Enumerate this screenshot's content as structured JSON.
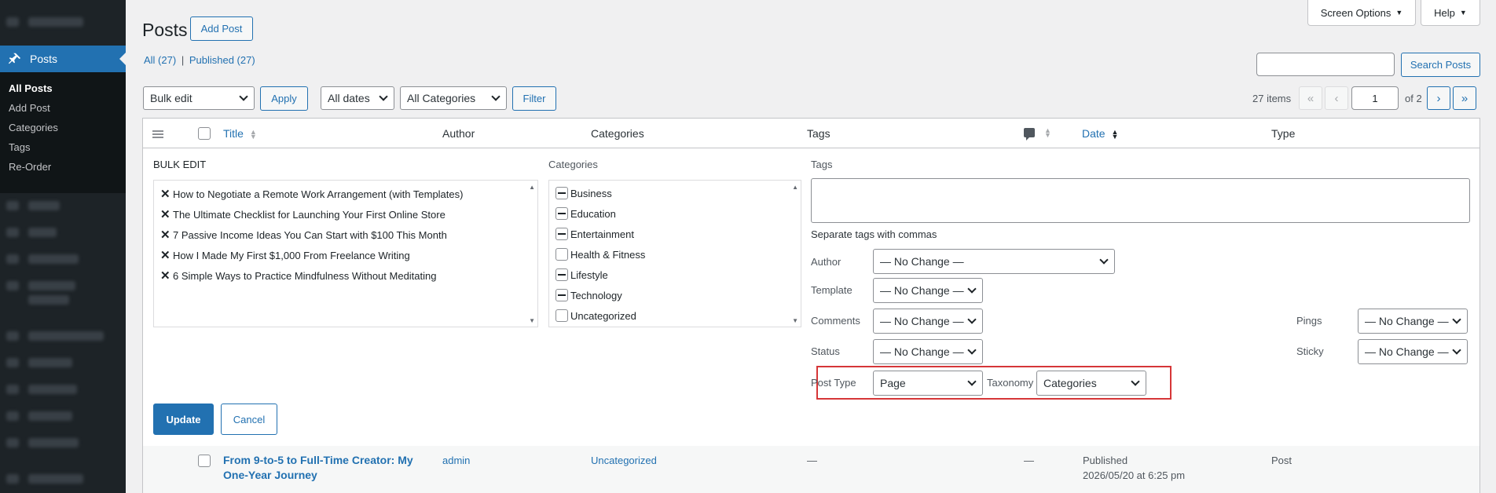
{
  "sidebar": {
    "posts_label": "Posts",
    "submenu": [
      "All Posts",
      "Add Post",
      "Categories",
      "Tags",
      "Re-Order"
    ]
  },
  "header": {
    "title": "Posts",
    "add_post": "Add Post",
    "screen_options": "Screen Options",
    "help": "Help"
  },
  "views": {
    "all": "All (27)",
    "sep": "|",
    "published": "Published (27)"
  },
  "search": {
    "button": "Search Posts",
    "value": ""
  },
  "filters": {
    "bulk_action": "Bulk edit",
    "apply": "Apply",
    "dates": "All dates",
    "categories": "All Categories",
    "filter": "Filter"
  },
  "pagination": {
    "items": "27 items",
    "first": "«",
    "prev": "‹",
    "current": "1",
    "of": "of 2",
    "next": "›",
    "last": "»"
  },
  "columns": {
    "title": "Title",
    "author": "Author",
    "categories": "Categories",
    "tags": "Tags",
    "date": "Date",
    "type": "Type"
  },
  "bulk_edit": {
    "heading": "BULK EDIT",
    "posts": [
      "How to Negotiate a Remote Work Arrangement (with Templates)",
      "The Ultimate Checklist for Launching Your First Online Store",
      "7 Passive Income Ideas You Can Start with $100 This Month",
      "How I Made My First $1,000 From Freelance Writing",
      "6 Simple Ways to Practice Mindfulness Without Meditating"
    ],
    "categories_label": "Categories",
    "categories": [
      {
        "name": "Business",
        "state": "indeterminate"
      },
      {
        "name": "Education",
        "state": "indeterminate"
      },
      {
        "name": "Entertainment",
        "state": "indeterminate"
      },
      {
        "name": "Health & Fitness",
        "state": "unchecked"
      },
      {
        "name": "Lifestyle",
        "state": "indeterminate"
      },
      {
        "name": "Technology",
        "state": "indeterminate"
      },
      {
        "name": "Uncategorized",
        "state": "unchecked"
      }
    ],
    "tags_label": "Tags",
    "tags_hint": "Separate tags with commas",
    "author_label": "Author",
    "author_value": "— No Change —",
    "template_label": "Template",
    "template_value": "— No Change —",
    "comments_label": "Comments",
    "comments_value": "— No Change —",
    "status_label": "Status",
    "status_value": "— No Change —",
    "pings_label": "Pings",
    "pings_value": "— No Change —",
    "sticky_label": "Sticky",
    "sticky_value": "— No Change —",
    "post_type_label": "Post Type",
    "post_type_value": "Page",
    "taxonomy_label": "Taxonomy",
    "taxonomy_value": "Categories",
    "update": "Update",
    "cancel": "Cancel"
  },
  "row": {
    "title": "From 9-to-5 to Full-Time Creator: My One-Year Journey",
    "author": "admin",
    "category": "Uncategorized",
    "tags": "—",
    "comments": "—",
    "date_status": "Published",
    "date": "2026/05/20 at 6:25 pm",
    "type": "Post"
  },
  "colors": {
    "accent": "#2271b1",
    "highlight": "#d63638"
  }
}
